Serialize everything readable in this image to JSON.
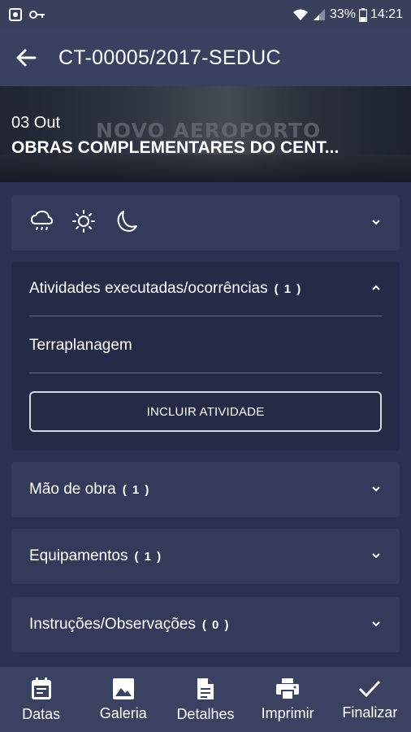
{
  "status": {
    "battery": "33%",
    "time": "14:21"
  },
  "appbar": {
    "title": "CT-00005/2017-SEDUC"
  },
  "hero": {
    "image_text": "NOVO AEROPORTO",
    "date": "03 Out",
    "subtitle": "OBRAS COMPLEMENTARES DO CENT..."
  },
  "weather": {
    "icons": [
      "rain-cloud-icon",
      "sun-icon",
      "moon-icon"
    ]
  },
  "activities": {
    "label": "Atividades executadas/ocorrências",
    "count": "( 1 )",
    "items": [
      "Terraplanagem"
    ],
    "add_button": "INCLUIR ATIVIDADE"
  },
  "sections": [
    {
      "label": "Mão de obra",
      "count": "( 1 )"
    },
    {
      "label": "Equipamentos",
      "count": "( 1 )"
    },
    {
      "label": "Instruções/Observações",
      "count": "( 0 )"
    }
  ],
  "nav": [
    {
      "label": "Datas",
      "icon": "calendar-icon"
    },
    {
      "label": "Galeria",
      "icon": "image-icon"
    },
    {
      "label": "Detalhes",
      "icon": "document-icon"
    },
    {
      "label": "Imprimir",
      "icon": "printer-icon"
    },
    {
      "label": "Finalizar",
      "icon": "check-icon"
    }
  ],
  "colors": {
    "background": "#2b3150",
    "card": "#343a59",
    "expanded_card": "#252a46",
    "appbar": "#3a4160"
  }
}
